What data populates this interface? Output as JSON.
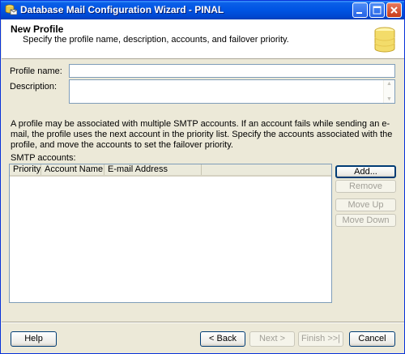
{
  "window": {
    "title": "Database Mail Configuration Wizard - PINAL"
  },
  "header": {
    "title": "New Profile",
    "subtitle": "Specify the profile name, description, accounts, and failover priority."
  },
  "form": {
    "profile_name_label": "Profile name:",
    "profile_name_value": "",
    "description_label": "Description:",
    "description_value": ""
  },
  "info_text": "A profile may be associated with multiple SMTP accounts. If an account fails while sending an e-mail, the profile uses the next account in the priority list. Specify the accounts associated with the profile, and move the accounts to set the failover priority.",
  "smtp": {
    "label": "SMTP accounts:",
    "columns": [
      "Priority",
      "Account Name",
      "E-mail Address"
    ],
    "rows": []
  },
  "side_buttons": {
    "add": "Add...",
    "remove": "Remove",
    "move_up": "Move Up",
    "move_down": "Move Down"
  },
  "footer_buttons": {
    "help": "Help",
    "back": "< Back",
    "next": "Next >",
    "finish": "Finish >>|",
    "cancel": "Cancel"
  }
}
